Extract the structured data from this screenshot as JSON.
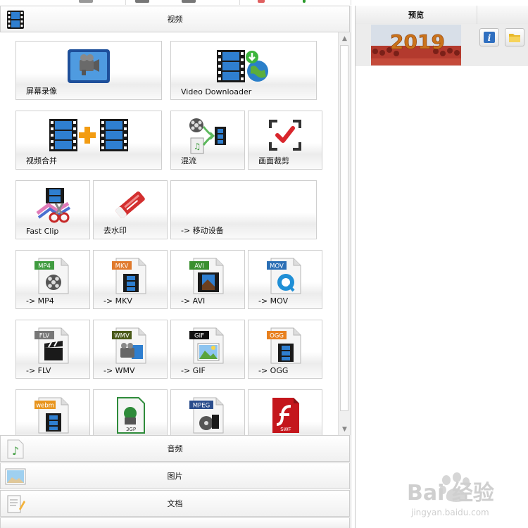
{
  "video_category": {
    "label": "视频",
    "tiles": [
      {
        "label": "屏幕录像",
        "icon": "screen-record-icon"
      },
      {
        "label": "Video Downloader",
        "icon": "video-downloader-icon"
      },
      {
        "label": "视频合并",
        "icon": "video-merge-icon"
      },
      {
        "label": "混流",
        "icon": "mux-icon"
      },
      {
        "label": "画面裁剪",
        "icon": "crop-icon"
      },
      {
        "label": "Fast Clip",
        "icon": "fast-clip-icon"
      },
      {
        "label": "去水印",
        "icon": "remove-watermark-icon"
      },
      {
        "label": "-> 移动设备",
        "icon": "mobile-device-icon"
      },
      {
        "label": "-> MP4",
        "badge": "MP4",
        "badge_color": "#3f9b3f",
        "icon": "mp4-file-icon"
      },
      {
        "label": "-> MKV",
        "badge": "MKV",
        "badge_color": "#e07a2c",
        "icon": "mkv-file-icon"
      },
      {
        "label": "-> AVI",
        "badge": "AVI",
        "badge_color": "#3a8f2f",
        "icon": "avi-file-icon"
      },
      {
        "label": "-> MOV",
        "badge": "MOV",
        "badge_color": "#2b6fb5",
        "icon": "mov-file-icon"
      },
      {
        "label": "-> FLV",
        "badge": "FLV",
        "badge_color": "#777777",
        "icon": "flv-file-icon"
      },
      {
        "label": "-> WMV",
        "badge": "WMV",
        "badge_color": "#4a5a1a",
        "icon": "wmv-file-icon"
      },
      {
        "label": "-> GIF",
        "badge": "GIF",
        "badge_color": "#111111",
        "icon": "gif-file-icon"
      },
      {
        "label": "-> OGG",
        "badge": "OGG",
        "badge_color": "#e8801e",
        "icon": "ogg-file-icon"
      },
      {
        "label": "",
        "badge": "webm",
        "badge_color": "#e8951e",
        "icon": "webm-file-icon"
      },
      {
        "label": "",
        "badge": "3GP",
        "badge_color": "#2e8b3a",
        "icon": "3gp-file-icon"
      },
      {
        "label": "",
        "badge": "MPEG",
        "badge_color": "#2a4d8c",
        "icon": "mpeg-file-icon"
      },
      {
        "label": "",
        "badge": "SWF",
        "badge_color": "#c4161c",
        "icon": "swf-file-icon"
      }
    ]
  },
  "other_categories": [
    {
      "label": "音频",
      "icon": "audio-icon"
    },
    {
      "label": "图片",
      "icon": "picture-icon"
    },
    {
      "label": "文档",
      "icon": "document-icon"
    }
  ],
  "preview": {
    "header": "预览",
    "thumbnail_text": "2019",
    "info_button_icon": "info-icon",
    "folder_button_icon": "folder-icon"
  },
  "watermark": {
    "brand": "Bai 经验",
    "url": "jingyan.baidu.com"
  },
  "colors": {
    "accent_orange": "#f39c12",
    "film_blue": "#2f7fd0",
    "crop_red": "#d9262c"
  }
}
